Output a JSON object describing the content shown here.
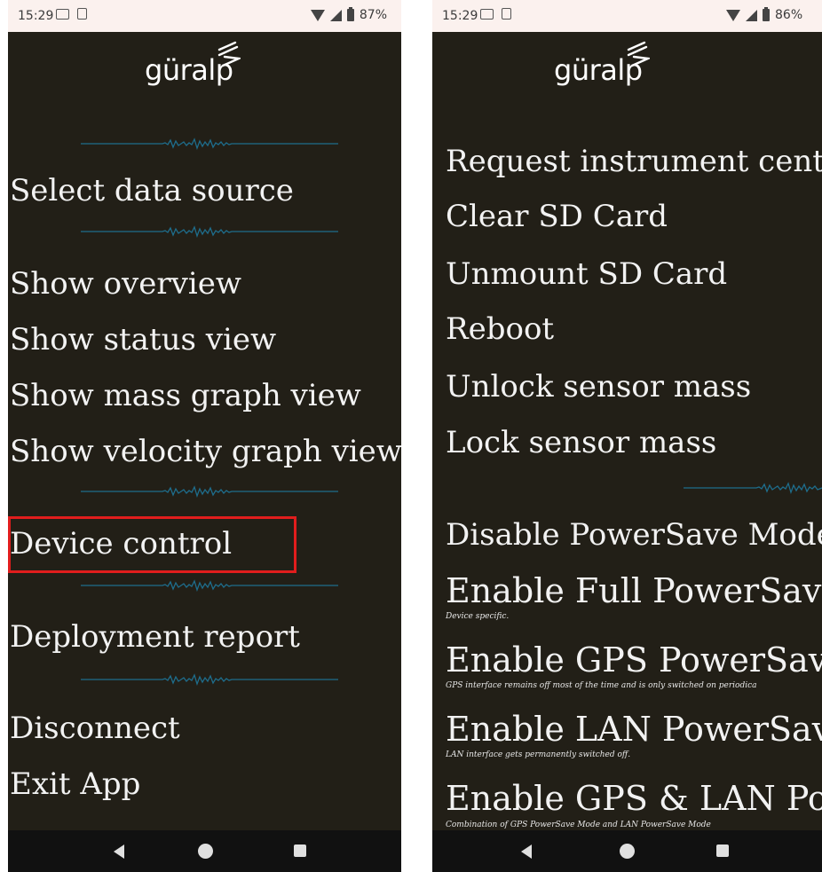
{
  "status_left": {
    "time": "15:29",
    "battery": "87%"
  },
  "status_right": {
    "time": "15:29",
    "battery": "86%"
  },
  "logo_text": "güralp",
  "left_menu": {
    "select_data_source": "Select data source",
    "show_overview": "Show overview",
    "show_status_view": "Show status view",
    "show_mass_graph_view": "Show mass graph view",
    "show_velocity_graph_view": "Show velocity graph view",
    "device_control": "Device control",
    "deployment_report": "Deployment report",
    "disconnect": "Disconnect",
    "exit_app": "Exit App"
  },
  "right_menu": {
    "request_instrument_centre": "Request instrument cente",
    "clear_sd_card": "Clear SD Card",
    "unmount_sd_card": "Unmount SD Card",
    "reboot": "Reboot",
    "unlock_sensor_mass": "Unlock sensor mass",
    "lock_sensor_mass": "Lock sensor mass",
    "disable_powersave": "Disable PowerSave Mode",
    "enable_full_powersave": "Enable Full PowerSave M",
    "enable_full_powersave_desc": "Device specific.",
    "enable_gps_powersave": "Enable GPS PowerSave M",
    "enable_gps_powersave_desc": "GPS interface remains off most of the time and is only switched on periodica",
    "enable_lan_powersave": "Enable LAN PowerSave M",
    "enable_lan_powersave_desc": "LAN interface gets permanently switched off.",
    "enable_gps_lan_powersave": "Enable GPS & LAN Power",
    "enable_gps_lan_powersave_desc": "Combination of GPS PowerSave Mode and LAN PowerSave Mode"
  },
  "icons": [
    "wifi-icon",
    "signal-icon",
    "battery-icon",
    "back-icon",
    "home-icon",
    "recents-icon",
    "waveform-divider-icon"
  ],
  "colors": {
    "background": "#221f17",
    "statusbar": "#fbf1ee",
    "highlight": "#e11d1d",
    "divider": "#1e6d8c"
  }
}
